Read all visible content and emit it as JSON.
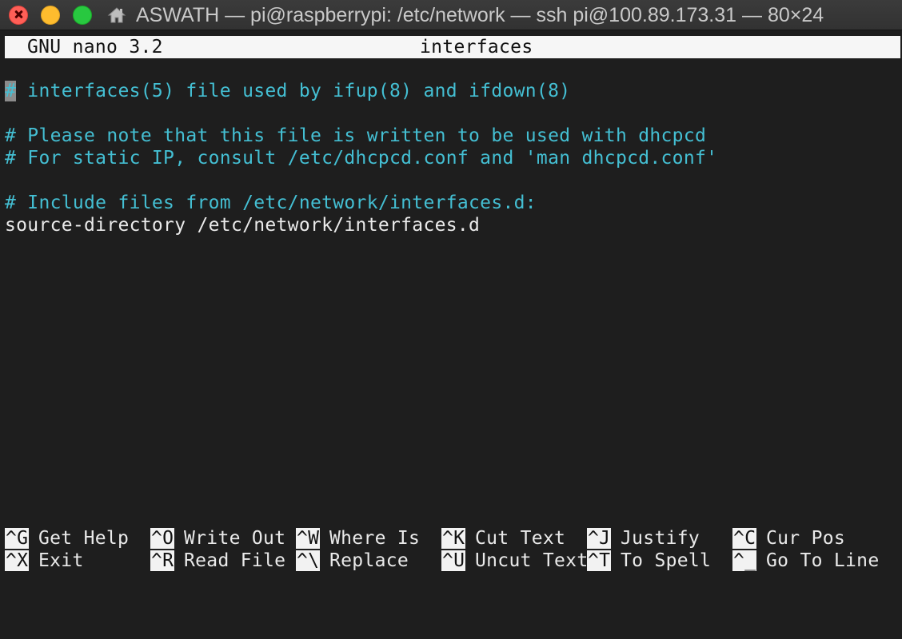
{
  "window": {
    "title": "ASWATH — pi@raspberrypi: /etc/network — ssh pi@100.89.173.31 — 80×24",
    "icon": "home-icon",
    "traffic_lights": {
      "close": "#ff5f57",
      "minimize": "#febc2e",
      "zoom": "#28c840"
    }
  },
  "nano": {
    "version": "GNU nano 3.2",
    "filename": "interfaces",
    "cursor_char": "#",
    "lines": [
      " interfaces(5) file used by ifup(8) and ifdown(8)",
      "",
      "# Please note that this file is written to be used with dhcpcd",
      "# For static IP, consult /etc/dhcpcd.conf and 'man dhcpcd.conf'",
      "",
      "# Include files from /etc/network/interfaces.d:",
      "source-directory /etc/network/interfaces.d"
    ],
    "shortcuts_row1": [
      {
        "key": "^G",
        "label": "Get Help"
      },
      {
        "key": "^O",
        "label": "Write Out"
      },
      {
        "key": "^W",
        "label": "Where Is"
      },
      {
        "key": "^K",
        "label": "Cut Text"
      },
      {
        "key": "^J",
        "label": "Justify"
      },
      {
        "key": "^C",
        "label": "Cur Pos"
      }
    ],
    "shortcuts_row2": [
      {
        "key": "^X",
        "label": "Exit"
      },
      {
        "key": "^R",
        "label": "Read File"
      },
      {
        "key": "^\\",
        "label": "Replace"
      },
      {
        "key": "^U",
        "label": "Uncut Text"
      },
      {
        "key": "^T",
        "label": "To Spell"
      },
      {
        "key": "^_",
        "label": "Go To Line"
      }
    ]
  },
  "colors": {
    "background": "#1e1e1e",
    "comment": "#44bfd3",
    "text": "#eaeaea",
    "header_bg": "#f6f6f6"
  }
}
